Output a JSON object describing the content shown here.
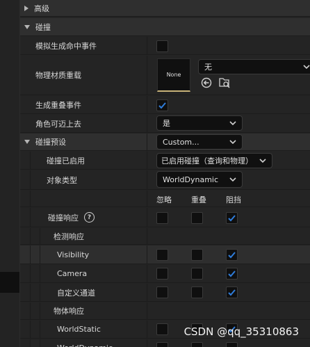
{
  "details": {
    "advanced": "高级",
    "collision": "碰撞",
    "simulation_hit_events": "模拟生成命中事件",
    "phys_material_override": "物理材质重载",
    "material_thumb": "None",
    "material_value": "无",
    "generate_overlap_events": "生成重叠事件",
    "can_character_step_up": "角色可迈上去",
    "step_up_value": "是",
    "collision_presets": "碰撞预设",
    "presets_value": "Custom...",
    "collision_enabled": "碰撞已启用",
    "collision_enabled_value": "已启用碰撞（查询和物理）",
    "object_type": "对象类型",
    "object_type_value": "WorldDynamic",
    "col_ignore": "忽略",
    "col_overlap": "重叠",
    "col_block": "阻挡",
    "collision_responses": "碰撞响应",
    "help_glyph": "?",
    "trace_responses": "检测响应",
    "visibility": "Visibility",
    "camera": "Camera",
    "custom_channel": "自定义通道",
    "object_responses": "物体响应",
    "world_static": "WorldStatic",
    "world_dynamic": "WorldDynamic"
  },
  "checkboxes": {
    "simulation_hit_events": false,
    "generate_overlap_events": true,
    "collision_responses": [
      "empty",
      "empty",
      "checked"
    ],
    "visibility": [
      "empty",
      "empty",
      "checked"
    ],
    "camera": [
      "empty",
      "empty",
      "checked"
    ],
    "custom_channel": [
      "empty",
      "empty",
      "checked"
    ],
    "world_static": [
      "empty",
      "empty",
      "checked"
    ]
  },
  "watermark": "CSDN @qq_35310863",
  "colors": {
    "check_mark": "#2f7ddb",
    "panel": "#242424",
    "section": "#2f2f2f",
    "field": "#101010"
  }
}
